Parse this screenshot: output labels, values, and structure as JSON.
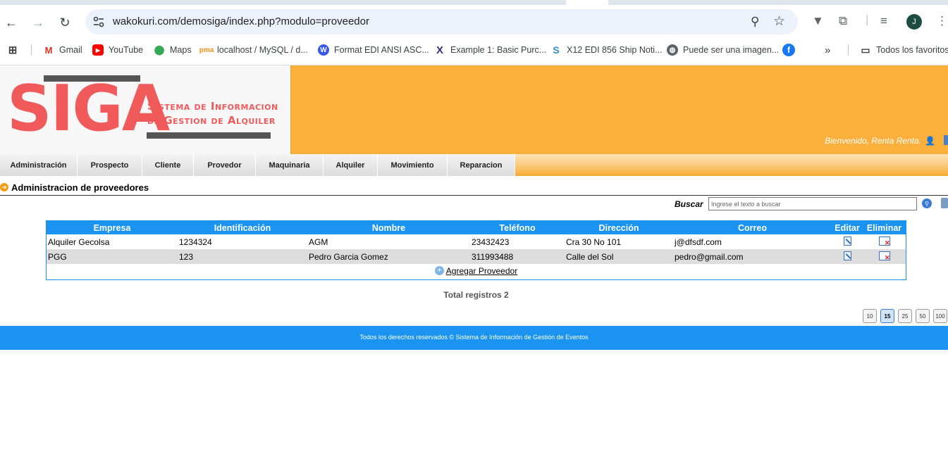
{
  "browser": {
    "url": "wakokuri.com/demosiga/index.php?modulo=proveedor",
    "profile_initial": "J",
    "bookmarks": [
      {
        "label": "Gmail",
        "icon": "gmail-icon"
      },
      {
        "label": "YouTube",
        "icon": "youtube-icon"
      },
      {
        "label": "Maps",
        "icon": "maps-icon"
      },
      {
        "label": "localhost / MySQL / d...",
        "icon": "phpmyadmin-icon"
      },
      {
        "label": "Format EDI ANSI ASC...",
        "icon": "wordpress-icon"
      },
      {
        "label": "Example 1: Basic Purc...",
        "icon": "x-icon"
      },
      {
        "label": "X12 EDI 856 Ship Noti...",
        "icon": "s-icon"
      },
      {
        "label": "Puede ser una imagen...",
        "icon": "globe-icon"
      }
    ],
    "all_bookmarks_label": "Todos los favoritos"
  },
  "header": {
    "logo_text": "SIGA",
    "logo_line1": "Sistema de Informacion",
    "logo_line2": "de Gestion de Alquiler",
    "welcome": "Bienvenido, Renta Renta."
  },
  "menu": {
    "items": [
      "Administración",
      "Prospecto",
      "Cliente",
      "Provedor",
      "Maquinaria",
      "Alquiler",
      "Movimiento",
      "Reparacion"
    ]
  },
  "page": {
    "title": "Administracion de proveedores",
    "search_label": "Buscar",
    "search_placeholder": "Ingrese el texto a buscar"
  },
  "grid": {
    "columns": [
      "Empresa",
      "Identificación",
      "Nombre",
      "Teléfono",
      "Dirección",
      "Correo",
      "Editar",
      "Eliminar"
    ],
    "rows": [
      {
        "empresa": "Alquiler Gecolsa",
        "identificacion": "1234324",
        "nombre": "AGM",
        "telefono": "23432423",
        "direccion": "Cra 30 No 101",
        "correo": "j@dfsdf.com"
      },
      {
        "empresa": "PGG",
        "identificacion": "123",
        "nombre": "Pedro Garcia Gomez",
        "telefono": "311993488",
        "direccion": "Calle del Sol",
        "correo": "pedro@gmail.com"
      }
    ],
    "add_label": "Agregar Proveedor",
    "total_label": "Total registros 2"
  },
  "pager": {
    "sizes": [
      "10",
      "15",
      "25",
      "50",
      "100"
    ],
    "active": "15"
  },
  "footer": {
    "text": "Todos los derechos reservados © Sistema de Información de Gestión de Eventos"
  },
  "colors": {
    "header_orange": "#fbb03b",
    "logo_red": "#f05a5a",
    "grid_blue": "#1a94f0"
  }
}
